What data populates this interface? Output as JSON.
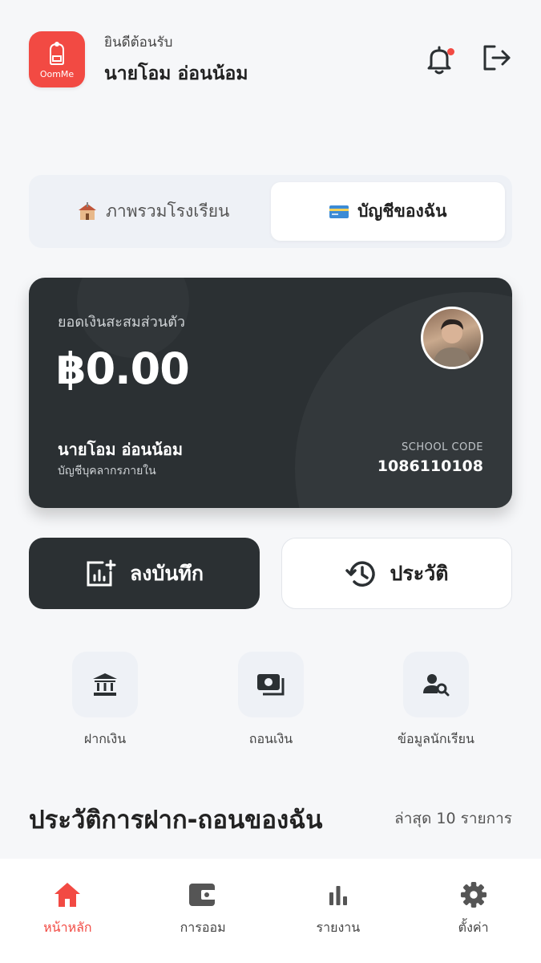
{
  "header": {
    "logo_text": "OomMe",
    "greeting": "ยินดีต้อนรับ",
    "user_name": "นายโอม อ่อนน้อม"
  },
  "tabs": [
    {
      "label": "ภาพรวมโรงเรียน",
      "icon": "school-icon",
      "active": false
    },
    {
      "label": "บัญชีของฉัน",
      "icon": "card-icon",
      "active": true
    }
  ],
  "balance_card": {
    "label": "ยอดเงินสะสมส่วนตัว",
    "amount": "฿0.00",
    "holder_name": "นายโอม อ่อนน้อม",
    "account_type": "บัญชีบุคลากรภายใน",
    "code_label": "SCHOOL CODE",
    "code_value": "1086110108"
  },
  "actions": {
    "record_label": "ลงบันทึก",
    "history_label": "ประวัติ"
  },
  "quick_menu": [
    {
      "label": "ฝากเงิน",
      "icon": "bank-icon"
    },
    {
      "label": "ถอนเงิน",
      "icon": "cash-icon"
    },
    {
      "label": "ข้อมูลนักเรียน",
      "icon": "student-search-icon"
    }
  ],
  "history_section": {
    "title": "ประวัติการฝาก-ถอนของฉัน",
    "subtitle": "ล่าสุด 10 รายการ"
  },
  "bottom_nav": [
    {
      "label": "หน้าหลัก",
      "icon": "home-icon",
      "active": true
    },
    {
      "label": "การออม",
      "icon": "wallet-icon",
      "active": false
    },
    {
      "label": "รายงาน",
      "icon": "bar-chart-icon",
      "active": false
    },
    {
      "label": "ตั้งค่า",
      "icon": "gear-icon",
      "active": false
    }
  ],
  "colors": {
    "accent": "#f24a43",
    "dark": "#2b3033",
    "background": "#f6f7f9"
  }
}
